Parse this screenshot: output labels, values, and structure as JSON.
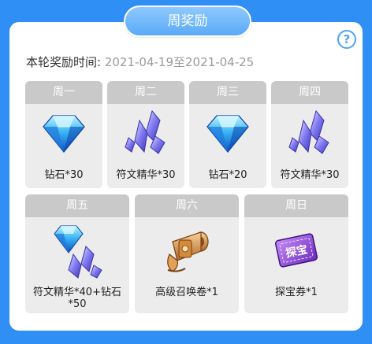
{
  "header": {
    "title": "周奖励"
  },
  "period": {
    "label": "本轮奖励时间:",
    "dates": "2021-04-19至2021-04-25"
  },
  "help": {
    "glyph": "?"
  },
  "rewards": [
    {
      "day": "周一",
      "item": "钻石*30",
      "icon": "diamond-icon"
    },
    {
      "day": "周二",
      "item": "符文精华*30",
      "icon": "rune-essence-icon"
    },
    {
      "day": "周三",
      "item": "钻石*20",
      "icon": "diamond-icon"
    },
    {
      "day": "周四",
      "item": "符文精华*30",
      "icon": "rune-essence-icon"
    },
    {
      "day": "周五",
      "item_line1": "符文精华*40+钻石",
      "item_line2": "*50",
      "icon": "diamond-and-rune-icon"
    },
    {
      "day": "周六",
      "item": "高级召唤卷*1",
      "icon": "summon-scroll-icon"
    },
    {
      "day": "周日",
      "item": "探宝券*1",
      "icon": "treasure-ticket-icon"
    }
  ],
  "ticket_text": "探宝",
  "colors": {
    "background": "#2f8ff5",
    "accent": "#4aa3f5",
    "card_header": "#c9c9c9",
    "card_body": "#ececec"
  }
}
